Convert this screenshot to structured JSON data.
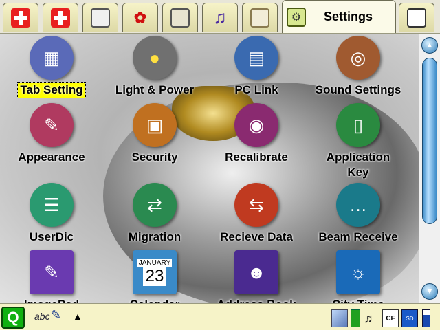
{
  "tabs": [
    {
      "icon": "first-aid-icon"
    },
    {
      "icon": "first-aid-icon"
    },
    {
      "icon": "clipboard-icon"
    },
    {
      "icon": "signal-icon"
    },
    {
      "icon": "book-icon"
    },
    {
      "icon": "music-icon"
    },
    {
      "icon": "dice-icon"
    },
    {
      "icon": "wrench-icon",
      "label": "Settings"
    },
    {
      "icon": "document-icon"
    }
  ],
  "apps": [
    {
      "label": "Tab Setting",
      "icon": "building-icon",
      "selected": true,
      "color": "#5a6ab8"
    },
    {
      "label": "Light & Power",
      "icon": "light-bulb-icon",
      "color": "#707070"
    },
    {
      "label": "PC Link",
      "icon": "laptop-icon",
      "color": "#3a6ab0"
    },
    {
      "label": "Sound Settings",
      "icon": "speaker-icon",
      "color": "#a05a30"
    },
    {
      "label": "Appearance",
      "icon": "appearance-icon",
      "color": "#b03a60"
    },
    {
      "label": "Security",
      "icon": "padlock-icon",
      "color": "#c07020"
    },
    {
      "label": "Recalibrate",
      "icon": "target-icon",
      "color": "#8a2a70"
    },
    {
      "label": "Application Key",
      "icon": "pda-key-icon",
      "color": "#2a8a40"
    },
    {
      "label": "UserDic",
      "icon": "notebook-icon",
      "color": "#2a9a70"
    },
    {
      "label": "Migration",
      "icon": "migration-icon",
      "color": "#2a8a50"
    },
    {
      "label": "Recieve Data",
      "icon": "receive-data-icon",
      "color": "#c03a20"
    },
    {
      "label": "Beam Receive",
      "icon": "beam-icon",
      "color": "#1a7a8a"
    },
    {
      "label": "ImagePad",
      "icon": "palette-icon",
      "color": "#6a3ab0"
    },
    {
      "label": "Calendar",
      "icon": "calendar-icon",
      "calendar_month": "JANUARY",
      "calendar_day": "23",
      "color": "#3a8ac8"
    },
    {
      "label": "Address Book",
      "icon": "contact-icon",
      "color": "#4a2a90"
    },
    {
      "label": "City Time",
      "icon": "globe-icon",
      "color": "#1a6ab8"
    }
  ],
  "taskbar": {
    "start_icon": "q-start-icon",
    "input_method": "abc",
    "tray_icons": [
      "display-icon",
      "network-icon",
      "volume-icon",
      "cf-card-icon",
      "sd-card-icon",
      "battery-icon"
    ],
    "cf_label": "CF",
    "sd_label": "SD"
  },
  "colors": {
    "tab_bg": "#f6f3c8",
    "selection": "#ffff00",
    "accent_red": "#e82020",
    "scroll_blue": "#3a8ac8"
  }
}
